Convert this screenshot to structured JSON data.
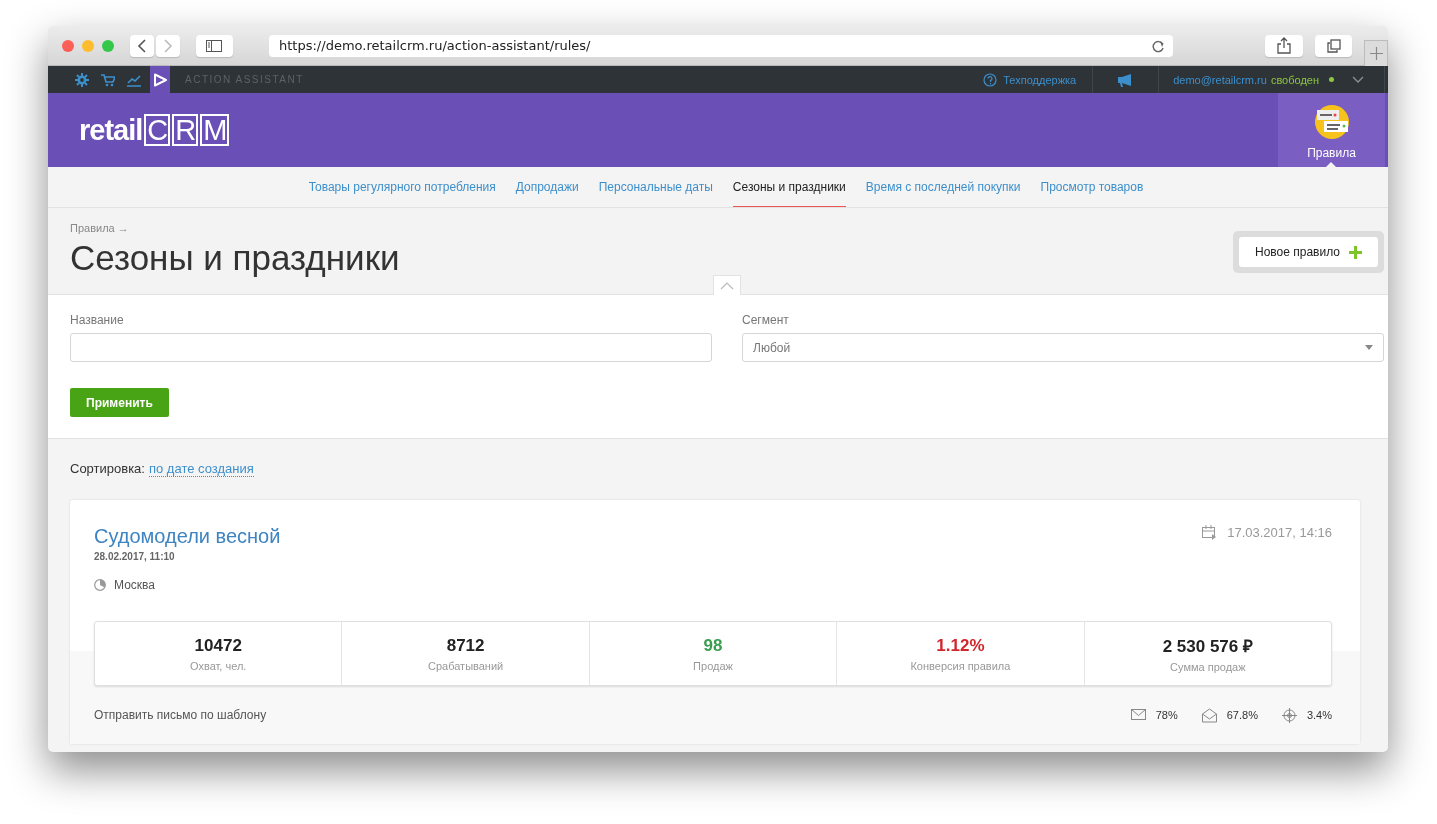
{
  "browser": {
    "url": "https://demo.retailcrm.ru/action-assistant/rules/"
  },
  "topbar": {
    "apps": [
      {
        "kind": "gear",
        "selected": false
      },
      {
        "kind": "cart",
        "selected": false
      },
      {
        "kind": "chart",
        "selected": false
      },
      {
        "kind": "play",
        "selected": true
      }
    ],
    "section": "ACTION ASSISTANT",
    "support": "Техподдержка",
    "user": "demo@retailcrm.ru",
    "status": "свободен"
  },
  "header": {
    "logo": "retailCRM",
    "module": "Правила"
  },
  "tabs": [
    {
      "label": "Товары регулярного потребления",
      "selected": false
    },
    {
      "label": "Допродажи",
      "selected": false
    },
    {
      "label": "Персональные даты",
      "selected": false
    },
    {
      "label": "Сезоны и праздники",
      "selected": true
    },
    {
      "label": "Время с последней покупки",
      "selected": false
    },
    {
      "label": "Просмотр товаров",
      "selected": false
    }
  ],
  "page": {
    "breadcrumb": "Правила →",
    "title": "Сезоны и праздники",
    "new_button": "Новое правило"
  },
  "filters": {
    "name_label": "Название",
    "segment_label": "Сегмент",
    "segment_value": "Любой",
    "apply": "Применить"
  },
  "sort": {
    "label": "Сортировка:",
    "value": "по дате создания"
  },
  "rules": [
    {
      "title": "Судомодели весной",
      "created": "28.02.2017, 11:10",
      "scheduled": "17.03.2017, 14:16",
      "segment": "Москва",
      "stats": [
        {
          "value": "10472",
          "label": "Охват, чел.",
          "color": "#222222"
        },
        {
          "value": "8712",
          "label": "Срабатываний",
          "color": "#222222"
        },
        {
          "value": "98",
          "label": "Продаж",
          "color": "#3a9d4f"
        },
        {
          "value": "1.12%",
          "label": "Конверсия правила",
          "color": "#d0262c"
        },
        {
          "value": "2 530 576 ₽",
          "label": "Сумма продаж",
          "color": "#222222"
        }
      ],
      "action": "Отправить письмо по шаблону",
      "metrics": [
        {
          "kind": "sent",
          "value": "78%"
        },
        {
          "kind": "opened",
          "value": "67.8%"
        },
        {
          "kind": "clicked",
          "value": "3.4%"
        }
      ]
    }
  ]
}
